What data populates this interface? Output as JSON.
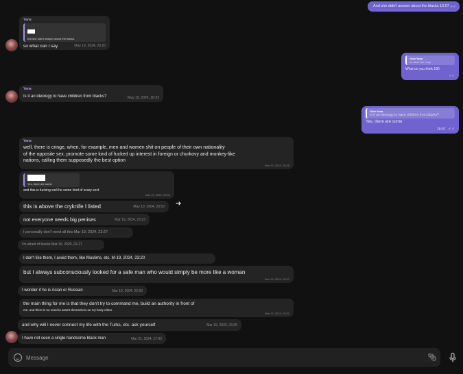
{
  "messages": {
    "m1": {
      "text": "And she didn't answer about the blacks 10:07"
    },
    "m2": {
      "sender": "Yana",
      "quote_text": "But she didn't answer about the blacks",
      "text": "so what can I say",
      "time": "May 19, 2024, 20:20"
    },
    "m3": {
      "quote_sender": "Gleb Yana",
      "quote_text": "so what can I say",
      "text": "What do you think 180"
    },
    "m4": {
      "sender": "Yana",
      "text": "Is it an ideology to have children from blacks?",
      "time": "May 19, 2024, 20-23"
    },
    "m5": {
      "quote_sender": "Gleb Yana",
      "quote_text": "Is it an ideology to have children from blacks?",
      "text": "Yes, there are some",
      "time": "18:07"
    },
    "m6": {
      "sender": "Yana",
      "line1": "well, there is cringe, when, for example, men and women shit on people of their own nationality",
      "line2": "of the opposite sex, promote some kind of fucked up interest in foreign or churkovy and monkey-like",
      "line3": "nations, calling them supposedly the best option",
      "time": "Mar 19, 2024, 20:49"
    },
    "m7": {
      "quote_text": "Yes, there are some",
      "text": "and this is fucking well he some kind of scary sect",
      "time": "Mar 19, 2020, 20:50"
    },
    "m8": {
      "text": "this is above the cryknife I listed",
      "time": "May 19, 2004, 20:50"
    },
    "m9": {
      "text": "not everyone needs big penises",
      "time": "Mar 19, 2024, 23:23"
    },
    "m10": {
      "text": "I personally don't need all this Mar 19, 2024, 23:27"
    },
    "m11": {
      "text": "I'm afraid of blacks Mar 19, 2020, 22-27"
    },
    "m12": {
      "text": "I don't like them, I avoid them, like Muslims, etc. M-19, 2024, 23:20"
    },
    "m13": {
      "text": "but I always subconsciously looked for a safe man who would simply be more like a woman",
      "time": "Mar 19, 2024, 23:27"
    },
    "m14": {
      "text": "I wonder if he is Asian or Russian",
      "time": "Mar 19, 2004, 22:29"
    },
    "m15": {
      "line1": "the main thing for me is that they don't try to command me, build an authority in front of",
      "line2": "me, and there is no need to assert themselves on my body either",
      "time": "Mar 19, 2024, 23:31"
    },
    "m16": {
      "text": "and why will I never connect my life with the Turks, etc. ask yourself",
      "time": "Mar 19, 2020, 23:35"
    },
    "m17": {
      "text": "I have not seen a single handsome black man",
      "time": "Mar 21, 2024, 17:43"
    }
  },
  "composer": {
    "placeholder": "Message"
  },
  "icons": [
    "emoji-icon",
    "attach-icon",
    "mic-icon",
    "forward-icon",
    "double-check-icon",
    "avatar"
  ],
  "colors": {
    "outgoing": "#7163cf",
    "incoming": "#242425",
    "background": "#111112",
    "accent": "#a9a1ea"
  }
}
